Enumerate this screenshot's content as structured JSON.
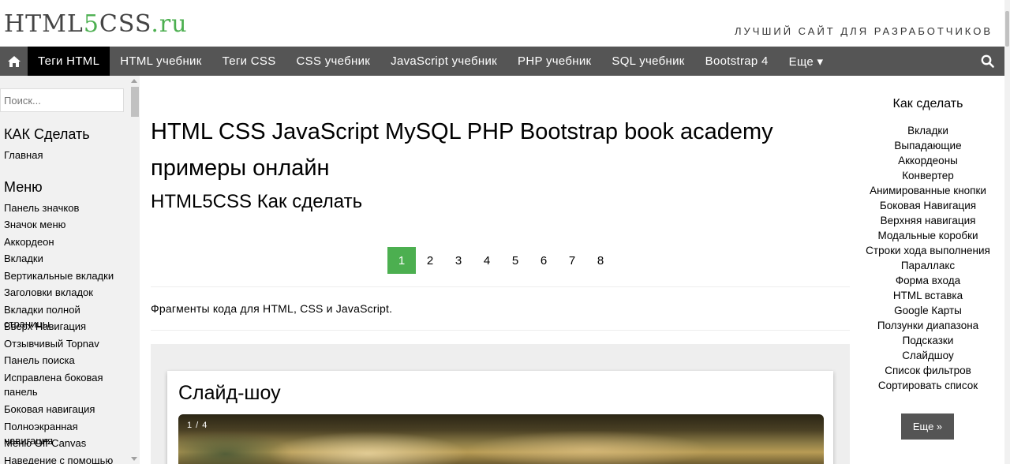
{
  "header": {
    "logo_prefix": "HTML",
    "logo_five": "5",
    "logo_css": "CSS",
    "logo_suffix": ".ru",
    "tagline": "ЛУЧШИЙ САЙТ ДЛЯ РАЗРАБОТЧИКОВ"
  },
  "topnav": {
    "items": [
      "Теги HTML",
      "HTML учебник",
      "Теги CSS",
      "CSS учебник",
      "JavaScript учебник",
      "PHP учебник",
      "SQL учебник",
      "Bootstrap 4",
      "Еще ▾"
    ],
    "active_index": 0
  },
  "sidebar": {
    "search_placeholder": "Поиск...",
    "section1_title": "КАК Сделать",
    "section1_links": [
      "Главная"
    ],
    "section2_title": "Меню",
    "links": [
      "Панель значков",
      "Значок меню",
      "Аккордеон",
      "Вкладки",
      "Вертикальные вкладки",
      "Заголовки вкладок",
      "Вкладки полной страницы",
      "Вверх Навигация",
      "Отзывчивый Topnav",
      "Панель поиска",
      "Исправлена боковая панель",
      "Боковая навигация",
      "Полноэкранная навигация",
      "Меню Off-Canvas",
      "Наведение с помощью"
    ]
  },
  "main": {
    "title": "HTML CSS JavaScript MySQL PHP Bootstrap book academy примеры онлайн",
    "subtitle": "HTML5CSS Как сделать",
    "pages": [
      "1",
      "2",
      "3",
      "4",
      "5",
      "6",
      "7",
      "8"
    ],
    "active_page": "1",
    "intro": "Фрагменты кода для HTML, CSS и JavaScript.",
    "card_title": "Слайд-шоу",
    "slide_counter": "1 / 4"
  },
  "right_sidebar": {
    "title": "Как сделать",
    "links": [
      "Вкладки",
      "Выпадающие",
      "Аккордеоны",
      "Конвертер",
      "Анимированные кнопки",
      "Боковая Навигация",
      "Верхняя навигация",
      "Модальные коробки",
      "Строки хода выполнения",
      "Параллакс",
      "Форма входа",
      "HTML вставка",
      "Google Карты",
      "Ползунки диапазона",
      "Подсказки",
      "Слайдшоу",
      "Список фильтров",
      "Сортировать список"
    ],
    "more_button": "Еще »"
  },
  "colors": {
    "accent": "#4CAF50",
    "nav_bg": "#555555",
    "nav_active": "#000000",
    "sidebar_bg": "#f1f1f1"
  },
  "icons": {
    "home": "home-icon",
    "search": "search-icon"
  }
}
